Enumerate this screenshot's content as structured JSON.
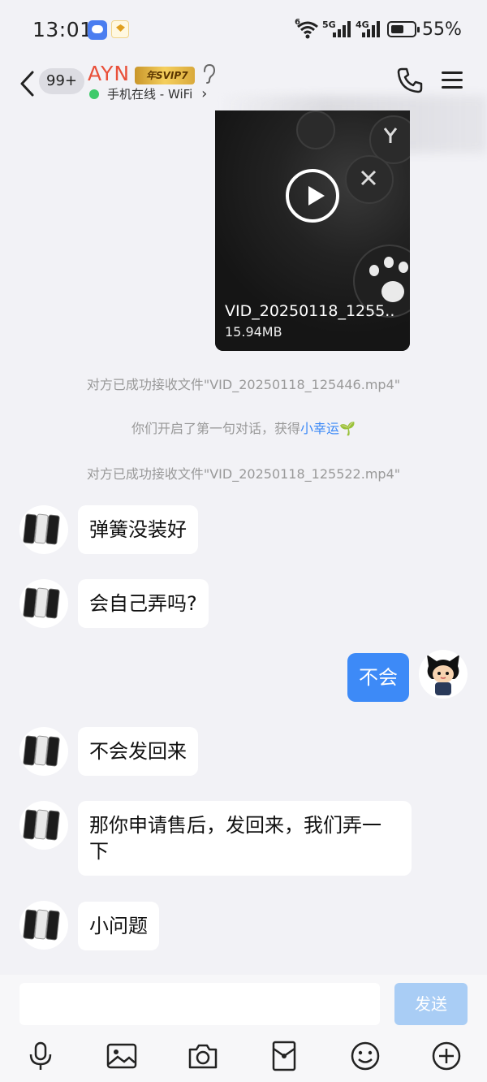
{
  "status_bar": {
    "time": "13:01",
    "net1": "5G",
    "net2": "4G",
    "wifi_sup": "6",
    "battery": "55%",
    "battery_level": 0.55
  },
  "header": {
    "unread_count": "99+",
    "contact_name": "AYN",
    "vip_label": "年SVIP7",
    "online_status": "手机在线 - WiFi",
    "online_arrow": "›"
  },
  "chat": {
    "video": {
      "filename": "VID_20250118_1255..",
      "size": "15.94MB"
    },
    "system_messages": [
      "对方已成功接收文件\"VID_20250118_125446.mp4\"",
      "你们开启了第一句对话，获得",
      "对方已成功接收文件\"VID_20250118_125522.mp4\""
    ],
    "lucky_link": "小幸运",
    "sprout": "🌱",
    "messages": [
      {
        "from": "them",
        "text": "弹簧没装好"
      },
      {
        "from": "them",
        "text": "会自己弄吗?"
      },
      {
        "from": "me",
        "text": "不会"
      },
      {
        "from": "them",
        "text": "不会发回来"
      },
      {
        "from": "them",
        "text": "那你申请售后，发回来，我们弄一下"
      },
      {
        "from": "them",
        "text": "小问题"
      }
    ]
  },
  "input": {
    "placeholder": "",
    "send_label": "发送"
  },
  "colors": {
    "accent": "#3d8af7",
    "name": "#e9503a",
    "online": "#3fca6b"
  },
  "icons": [
    "microphone-icon",
    "image-icon",
    "camera-icon",
    "red-packet-icon",
    "emoji-icon",
    "plus-icon"
  ]
}
